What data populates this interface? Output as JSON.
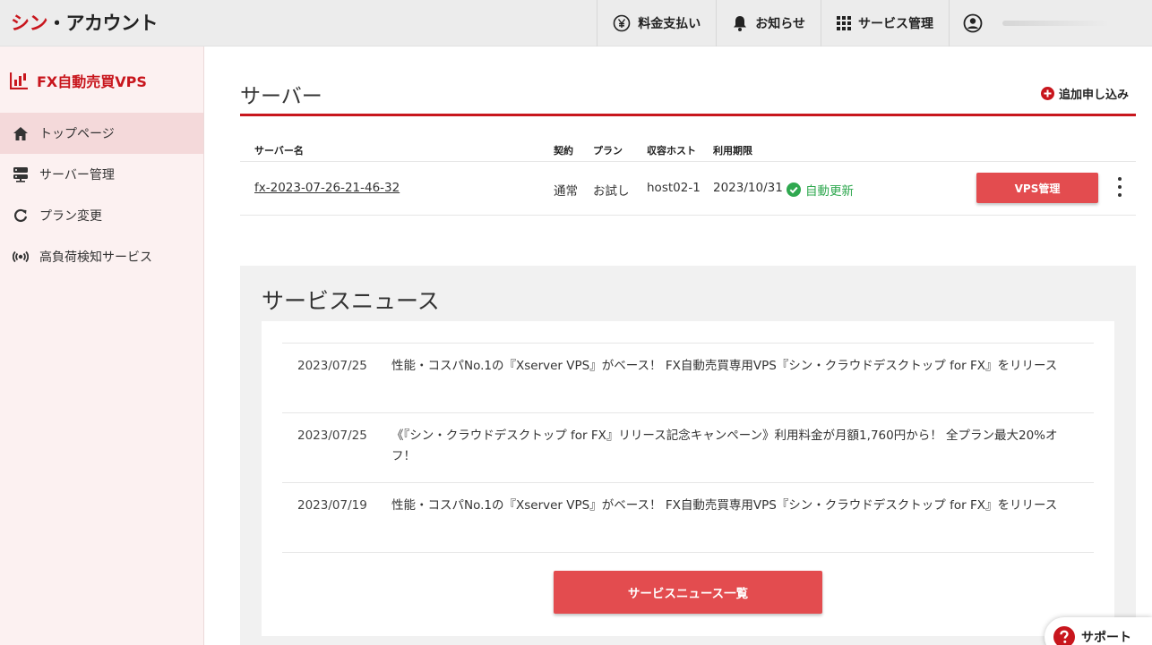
{
  "header": {
    "brand_part1": "シン",
    "brand_part2": "・アカウント",
    "nav": [
      {
        "label": "料金支払い",
        "icon": "yen-circle-icon"
      },
      {
        "label": "お知らせ",
        "icon": "bell-icon"
      },
      {
        "label": "サービス管理",
        "icon": "grid-icon"
      }
    ],
    "user_icon": "user-circle-icon"
  },
  "sidebar": {
    "title": "FX自動売買VPS",
    "items": [
      {
        "label": "トップページ",
        "icon": "home-icon",
        "active": true
      },
      {
        "label": "サーバー管理",
        "icon": "server-icon"
      },
      {
        "label": "プラン変更",
        "icon": "refresh-icon"
      },
      {
        "label": "高負荷検知サービス",
        "icon": "broadcast-icon"
      }
    ]
  },
  "servers": {
    "title": "サーバー",
    "add_label": "追加申し込み",
    "columns": {
      "name": "サーバー名",
      "contract": "契約",
      "plan": "プラン",
      "host": "収容ホスト",
      "expiry": "利用期限"
    },
    "rows": [
      {
        "name": "fx-2023-07-26-21-46-32",
        "contract": "通常",
        "plan": "お試し",
        "host": "host02-1",
        "expiry": "2023/10/31",
        "status": "自動更新",
        "action": "VPS管理"
      }
    ]
  },
  "news": {
    "title": "サービスニュース",
    "items": [
      {
        "date": "2023/07/25",
        "text": "性能・コスパNo.1の『Xserver VPS』がベース！ FX自動売買専用VPS『シン・クラウドデスクトップ for FX』をリリース"
      },
      {
        "date": "2023/07/25",
        "text": "《『シン・クラウドデスクトップ for FX』リリース記念キャンペーン》利用料金が月額1,760円から！ 全プラン最大20%オフ！"
      },
      {
        "date": "2023/07/19",
        "text": "性能・コスパNo.1の『Xserver VPS』がベース！ FX自動売買専用VPS『シン・クラウドデスクトップ for FX』をリリース"
      }
    ],
    "all_button": "サービスニュース一覧"
  },
  "support": {
    "label": "サポート"
  },
  "colors": {
    "brand_red": "#c8161d",
    "button_red": "#e34c4f",
    "success_green": "#2fa84f",
    "sidebar_bg": "#fcf1f1",
    "sidebar_active": "#f4d9da"
  }
}
